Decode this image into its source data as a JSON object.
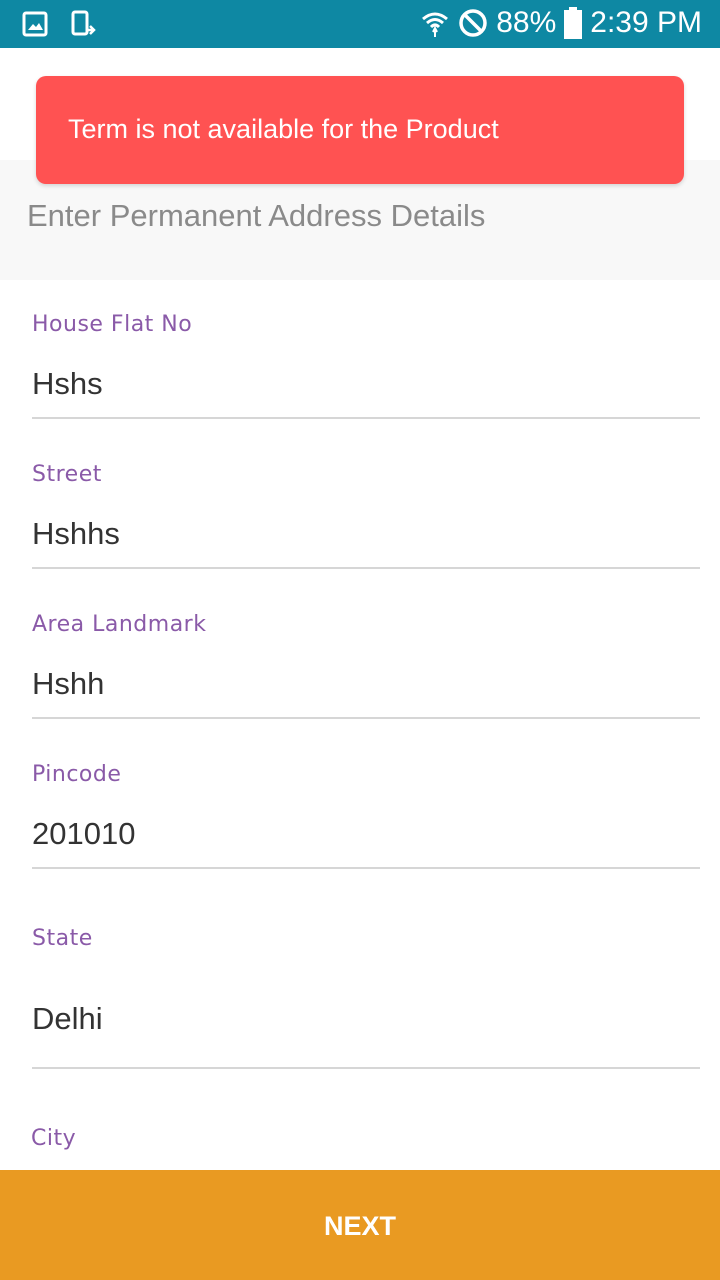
{
  "status_bar": {
    "battery": "88%",
    "time": "2:39 PM",
    "icons": [
      "image-icon",
      "device-icon",
      "wifi-icon",
      "blocked-icon",
      "battery-icon"
    ]
  },
  "toast": {
    "message": "Term is not available for the Product",
    "color": "#ff5252"
  },
  "section": {
    "title": "Enter Permanent Address Details"
  },
  "form": {
    "fields": [
      {
        "label": "House Flat No",
        "value": "Hshs"
      },
      {
        "label": "Street",
        "value": "Hshhs"
      },
      {
        "label": "Area Landmark",
        "value": "Hshh"
      },
      {
        "label": "Pincode",
        "value": "201010"
      },
      {
        "label": "State",
        "value": "Delhi"
      },
      {
        "label": "City",
        "value": ""
      }
    ]
  },
  "footer": {
    "next_label": "NEXT"
  },
  "colors": {
    "status_bar": "#0e88a3",
    "label": "#8a5aa8",
    "accent_button": "#e99a22"
  }
}
